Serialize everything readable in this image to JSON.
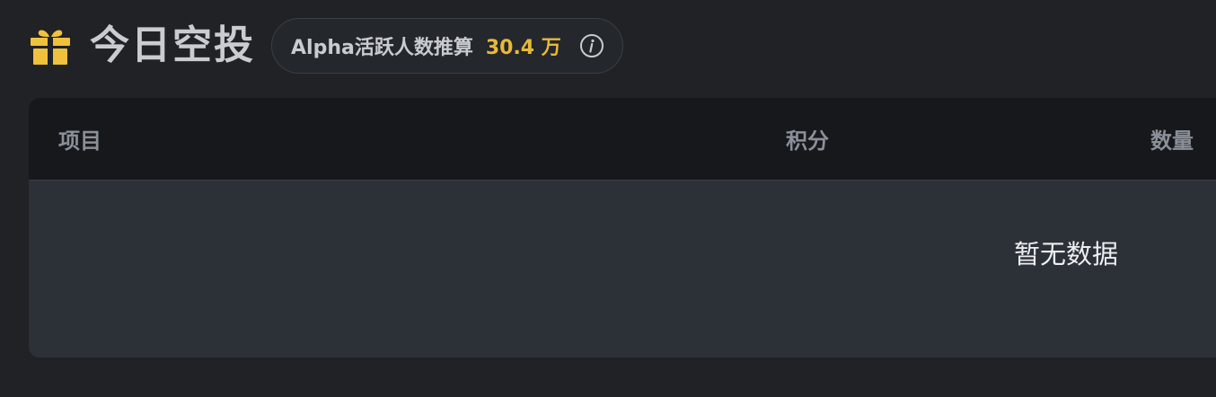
{
  "header": {
    "icon": "gift-icon",
    "title": "今日空投",
    "stat_label": "Alpha活跃人数推算",
    "stat_value": "30.4 万",
    "info_icon": "info-icon"
  },
  "table": {
    "columns": [
      "项目",
      "积分",
      "数量"
    ],
    "empty_text": "暂无数据"
  },
  "colors": {
    "background": "#202226",
    "accent": "#e7b93b",
    "table_header": "#16181c",
    "table_body": "#2c3037"
  }
}
